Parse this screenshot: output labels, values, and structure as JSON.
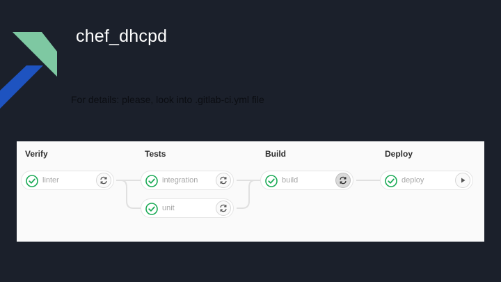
{
  "slide": {
    "title": "chef_dhcpd",
    "subtitle": "For details: please, look into .gitlab-ci.yml file"
  },
  "colors": {
    "background": "#1b202b",
    "logo_green": "#7ec8a2",
    "logo_blue": "#1e53c0",
    "success_green": "#1aaa55"
  },
  "pipeline": {
    "stages": [
      {
        "title": "Verify",
        "jobs": [
          {
            "name": "linter",
            "status_icon": "success-check-icon",
            "action_icon": "retry-icon"
          }
        ]
      },
      {
        "title": "Tests",
        "jobs": [
          {
            "name": "integration",
            "status_icon": "success-check-icon",
            "action_icon": "retry-icon"
          },
          {
            "name": "unit",
            "status_icon": "success-check-icon",
            "action_icon": "retry-icon"
          }
        ]
      },
      {
        "title": "Build",
        "jobs": [
          {
            "name": "build",
            "status_icon": "success-check-icon",
            "action_icon": "retry-icon"
          }
        ]
      },
      {
        "title": "Deploy",
        "jobs": [
          {
            "name": "deploy",
            "status_icon": "success-check-icon",
            "action_icon": "play-icon"
          }
        ]
      }
    ]
  }
}
